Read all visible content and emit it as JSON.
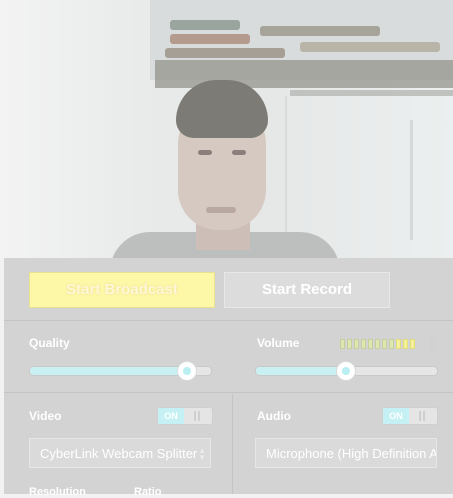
{
  "controls": {
    "broadcast_label": "Start Broadcast",
    "record_label": "Start Record"
  },
  "quality": {
    "label": "Quality",
    "level": 0.86
  },
  "volume": {
    "label": "Volume",
    "level": 0.49,
    "meter_segments": 11,
    "meter_lit": 3
  },
  "video": {
    "label": "Video",
    "toggle_on": "ON",
    "device": "CyberLink Webcam Splitter",
    "resolution_label": "Resolution",
    "ratio_label": "Ratio"
  },
  "audio": {
    "label": "Audio",
    "toggle_on": "ON",
    "device": "Microphone (High Definition Audio Device)"
  },
  "colors": {
    "broadcast_button": "#fdf7a8",
    "slider_accent": "#c9f1f4",
    "panel_bg": "#d3d3d3"
  }
}
